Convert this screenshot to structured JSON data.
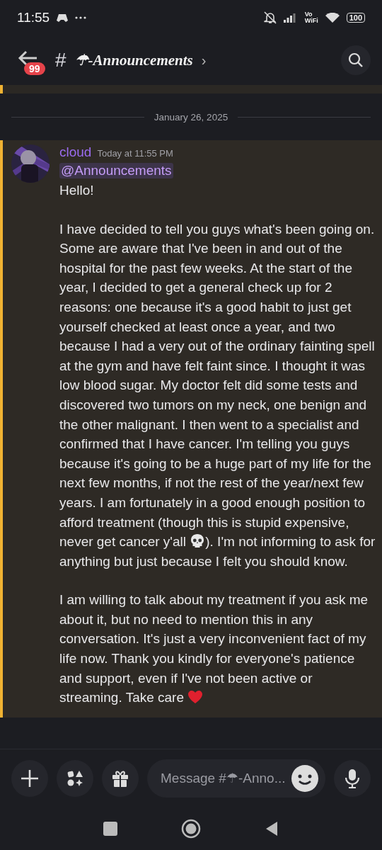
{
  "status_bar": {
    "time": "11:55",
    "battery": "100",
    "network": "Vo\nWiFi"
  },
  "header": {
    "unread_badge": "99",
    "hash": "#",
    "channel": "☂-Announcements",
    "chevron": "›"
  },
  "date_divider": "January 26, 2025",
  "message": {
    "author": "cloud",
    "timestamp": "Today at 11:55 PM",
    "mention": "@Announcements",
    "highlighted": true,
    "paragraphs": [
      [
        {
          "kind": "text",
          "text": "Hello!"
        }
      ],
      [
        {
          "kind": "text",
          "text": "I have decided to tell you guys what's been going on. Some are aware that I've been in and out of the hospital for the past few weeks. At the start of the year, I decided to get a general check up for 2 reasons: one because it's a good habit to just get yourself checked at least once a year, and two because I had a very out of the ordinary fainting spell at the gym and have felt faint since. I thought it was low blood sugar. My doctor felt did some tests and discovered two tumors on my neck, one benign and the other malignant. I then went to a specialist and confirmed that I have cancer. I'm telling you guys because it's going to be a huge part of my life for the next few months, if not the rest of the year/next few years. I am fortunately in a good enough position to afford treatment (though this is stupid expensive, never get cancer y'all "
        },
        {
          "kind": "skull"
        },
        {
          "kind": "text",
          "text": "). I'm not informing to ask for anything but just because I felt you should know."
        }
      ],
      [
        {
          "kind": "text",
          "text": "I am willing to talk about my treatment if you ask me about it, but no need to mention this in any conversation. It's just a very inconvenient fact of my life now. Thank you kindly for everyone's patience and support, even if I've not been active or streaming. Take care "
        },
        {
          "kind": "heart"
        }
      ]
    ]
  },
  "composer": {
    "placeholder": "Message #☂-Anno..."
  }
}
